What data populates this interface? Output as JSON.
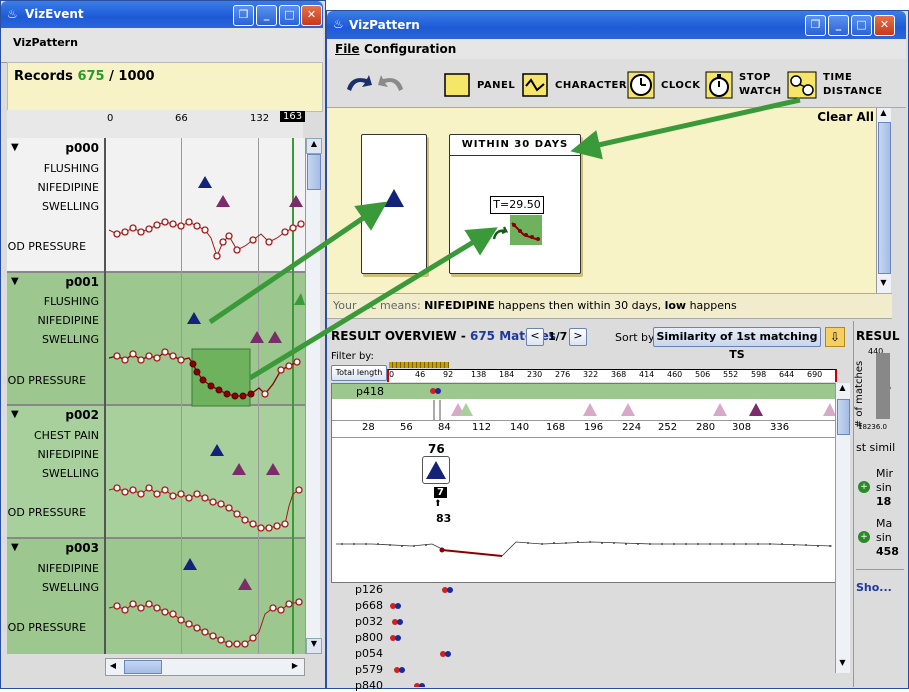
{
  "left_window": {
    "title": "VizEvent",
    "menu_label": "VizPattern",
    "records_prefix": "Records ",
    "records_count": "675",
    "records_sep": " / ",
    "records_total": "1000",
    "axis_ticks": [
      "0",
      "66",
      "132"
    ],
    "axis_badge": "163",
    "records": [
      {
        "id": "p000",
        "labels": [
          "FLUSHING",
          "NIFEDIPINE",
          "SWELLING",
          "OOD PRESSURE"
        ]
      },
      {
        "id": "p001",
        "labels": [
          "FLUSHING",
          "NIFEDIPINE",
          "SWELLING",
          "OOD PRESSURE"
        ]
      },
      {
        "id": "p002",
        "labels": [
          "CHEST PAIN",
          "NIFEDIPINE",
          "SWELLING",
          "OOD PRESSURE"
        ]
      },
      {
        "id": "p003",
        "labels": [
          "NIFEDIPINE",
          "SWELLING",
          "OOD PRESSURE"
        ]
      }
    ]
  },
  "right_window": {
    "title": "VizPattern",
    "menu": [
      "File",
      "Configuration"
    ],
    "toolbar": {
      "panel": "PANEL",
      "character": "CHARACTER",
      "clock": "CLOCK",
      "stopwatch_1": "STOP",
      "stopwatch_2": "WATCH",
      "distance_1": "TIME",
      "distance_2": "DISTANCE"
    },
    "clear_all": "Clear All",
    "panel_title": "WITHIN 30 DAYS",
    "time_box": "T=29.50",
    "query_text_prefix": "Your ",
    "query_text_partial": "...c means: ",
    "query_event": "NIFEDIPINE",
    "query_mid": " happens then within 30 days, ",
    "query_low": "low",
    "query_end": " happens",
    "result_title": "RESULT OVERVIEW - ",
    "result_count": "675 Matches",
    "page_prev": "<",
    "page_text": "1/7",
    "page_next": ">",
    "sort_by_label": "Sort by",
    "sort_value": "Similarity of 1st matching TS",
    "filter_label": "Filter by:",
    "filter_button": "Total length",
    "filter_ticks": [
      "0",
      "46",
      "92",
      "138",
      "184",
      "230",
      "276",
      "322",
      "368",
      "414",
      "460",
      "506",
      "552",
      "598",
      "644",
      "690"
    ],
    "selected_record": "p418",
    "detail_ticks": [
      "28",
      "56",
      "84",
      "112",
      "140",
      "168",
      "196",
      "224",
      "252",
      "280",
      "308",
      "336"
    ],
    "event_value": "76",
    "duration_value": "7",
    "end_value": "83",
    "record_list": [
      "p126",
      "p668",
      "p032",
      "p800",
      "p054",
      "p579",
      "p840"
    ],
    "side_panel": {
      "title_partial": "RESUL",
      "y_label": "# of matches",
      "y_top": "440",
      "y_mid": "235",
      "x_labels": "18236.0",
      "similarity_partial": "st simil",
      "min_label": "Mir",
      "min_sub": "sin",
      "min_value": "18",
      "max_label": "Ma",
      "max_sub": "sin",
      "max_value": "458",
      "show": "Sho..."
    }
  },
  "colors": {
    "title_bar": "#2160d8",
    "panel_yellow": "#f7f3c7",
    "record_green": "#9cc78f",
    "dark_green": "#3a8a3a",
    "navy": "#15227a",
    "purple": "#7c2b6b",
    "maroon": "#8b0000"
  }
}
